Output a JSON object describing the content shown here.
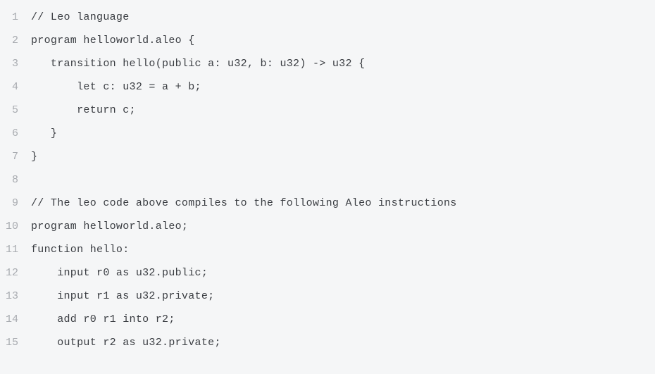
{
  "code_lines": [
    {
      "num": "1",
      "text": "// Leo language"
    },
    {
      "num": "2",
      "text": "program helloworld.aleo {"
    },
    {
      "num": "3",
      "text": "   transition hello(public a: u32, b: u32) -> u32 {"
    },
    {
      "num": "4",
      "text": "       let c: u32 = a + b;"
    },
    {
      "num": "5",
      "text": "       return c;"
    },
    {
      "num": "6",
      "text": "   }"
    },
    {
      "num": "7",
      "text": "}"
    },
    {
      "num": "8",
      "text": ""
    },
    {
      "num": "9",
      "text": "// The leo code above compiles to the following Aleo instructions"
    },
    {
      "num": "10",
      "text": "program helloworld.aleo;"
    },
    {
      "num": "11",
      "text": "function hello:"
    },
    {
      "num": "12",
      "text": "    input r0 as u32.public;"
    },
    {
      "num": "13",
      "text": "    input r1 as u32.private;"
    },
    {
      "num": "14",
      "text": "    add r0 r1 into r2;"
    },
    {
      "num": "15",
      "text": "    output r2 as u32.private;"
    }
  ]
}
